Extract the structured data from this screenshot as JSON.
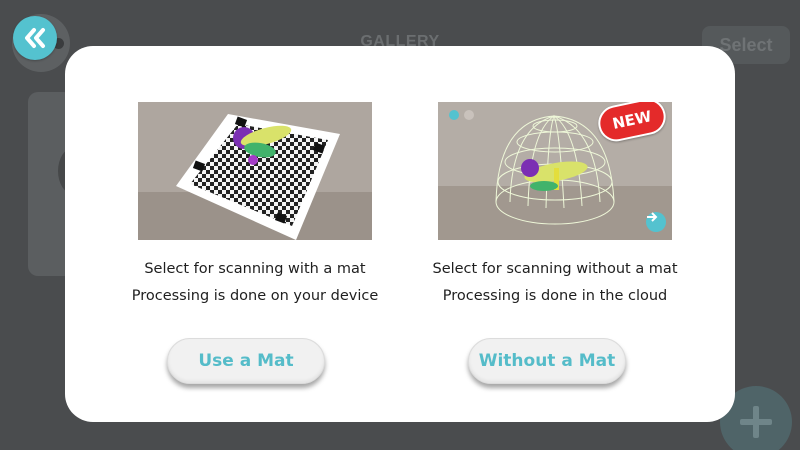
{
  "app": {
    "header_title": "GALLERY",
    "select_label": "Select",
    "back_icon": "double-chevron-left-icon",
    "add_icon": "plus-icon"
  },
  "dialog": {
    "options": [
      {
        "id": "mat",
        "description_line1": "Select for scanning with a mat",
        "description_line2": "Processing is done on your device",
        "button_label": "Use a Mat",
        "image": "scanning-mat-with-object-photo"
      },
      {
        "id": "no-mat",
        "description_line1": "Select for scanning without a mat",
        "description_line2": "Processing is done in the cloud",
        "button_label": "Without a Mat",
        "badge": "NEW",
        "image": "object-with-wireframe-dome-photo"
      }
    ]
  },
  "colors": {
    "accent": "#54c2cf",
    "badge": "#e42a2a",
    "background": "#4a4c4e",
    "modal": "#ffffff"
  }
}
